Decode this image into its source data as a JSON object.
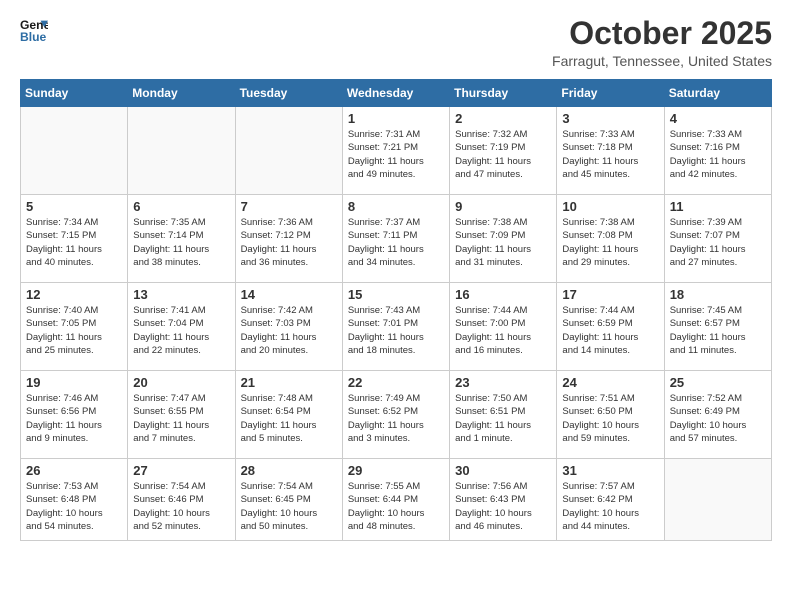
{
  "header": {
    "logo_line1": "General",
    "logo_line2": "Blue",
    "month": "October 2025",
    "location": "Farragut, Tennessee, United States"
  },
  "weekdays": [
    "Sunday",
    "Monday",
    "Tuesday",
    "Wednesday",
    "Thursday",
    "Friday",
    "Saturday"
  ],
  "weeks": [
    [
      {
        "day": "",
        "info": ""
      },
      {
        "day": "",
        "info": ""
      },
      {
        "day": "",
        "info": ""
      },
      {
        "day": "1",
        "info": "Sunrise: 7:31 AM\nSunset: 7:21 PM\nDaylight: 11 hours\nand 49 minutes."
      },
      {
        "day": "2",
        "info": "Sunrise: 7:32 AM\nSunset: 7:19 PM\nDaylight: 11 hours\nand 47 minutes."
      },
      {
        "day": "3",
        "info": "Sunrise: 7:33 AM\nSunset: 7:18 PM\nDaylight: 11 hours\nand 45 minutes."
      },
      {
        "day": "4",
        "info": "Sunrise: 7:33 AM\nSunset: 7:16 PM\nDaylight: 11 hours\nand 42 minutes."
      }
    ],
    [
      {
        "day": "5",
        "info": "Sunrise: 7:34 AM\nSunset: 7:15 PM\nDaylight: 11 hours\nand 40 minutes."
      },
      {
        "day": "6",
        "info": "Sunrise: 7:35 AM\nSunset: 7:14 PM\nDaylight: 11 hours\nand 38 minutes."
      },
      {
        "day": "7",
        "info": "Sunrise: 7:36 AM\nSunset: 7:12 PM\nDaylight: 11 hours\nand 36 minutes."
      },
      {
        "day": "8",
        "info": "Sunrise: 7:37 AM\nSunset: 7:11 PM\nDaylight: 11 hours\nand 34 minutes."
      },
      {
        "day": "9",
        "info": "Sunrise: 7:38 AM\nSunset: 7:09 PM\nDaylight: 11 hours\nand 31 minutes."
      },
      {
        "day": "10",
        "info": "Sunrise: 7:38 AM\nSunset: 7:08 PM\nDaylight: 11 hours\nand 29 minutes."
      },
      {
        "day": "11",
        "info": "Sunrise: 7:39 AM\nSunset: 7:07 PM\nDaylight: 11 hours\nand 27 minutes."
      }
    ],
    [
      {
        "day": "12",
        "info": "Sunrise: 7:40 AM\nSunset: 7:05 PM\nDaylight: 11 hours\nand 25 minutes."
      },
      {
        "day": "13",
        "info": "Sunrise: 7:41 AM\nSunset: 7:04 PM\nDaylight: 11 hours\nand 22 minutes."
      },
      {
        "day": "14",
        "info": "Sunrise: 7:42 AM\nSunset: 7:03 PM\nDaylight: 11 hours\nand 20 minutes."
      },
      {
        "day": "15",
        "info": "Sunrise: 7:43 AM\nSunset: 7:01 PM\nDaylight: 11 hours\nand 18 minutes."
      },
      {
        "day": "16",
        "info": "Sunrise: 7:44 AM\nSunset: 7:00 PM\nDaylight: 11 hours\nand 16 minutes."
      },
      {
        "day": "17",
        "info": "Sunrise: 7:44 AM\nSunset: 6:59 PM\nDaylight: 11 hours\nand 14 minutes."
      },
      {
        "day": "18",
        "info": "Sunrise: 7:45 AM\nSunset: 6:57 PM\nDaylight: 11 hours\nand 11 minutes."
      }
    ],
    [
      {
        "day": "19",
        "info": "Sunrise: 7:46 AM\nSunset: 6:56 PM\nDaylight: 11 hours\nand 9 minutes."
      },
      {
        "day": "20",
        "info": "Sunrise: 7:47 AM\nSunset: 6:55 PM\nDaylight: 11 hours\nand 7 minutes."
      },
      {
        "day": "21",
        "info": "Sunrise: 7:48 AM\nSunset: 6:54 PM\nDaylight: 11 hours\nand 5 minutes."
      },
      {
        "day": "22",
        "info": "Sunrise: 7:49 AM\nSunset: 6:52 PM\nDaylight: 11 hours\nand 3 minutes."
      },
      {
        "day": "23",
        "info": "Sunrise: 7:50 AM\nSunset: 6:51 PM\nDaylight: 11 hours\nand 1 minute."
      },
      {
        "day": "24",
        "info": "Sunrise: 7:51 AM\nSunset: 6:50 PM\nDaylight: 10 hours\nand 59 minutes."
      },
      {
        "day": "25",
        "info": "Sunrise: 7:52 AM\nSunset: 6:49 PM\nDaylight: 10 hours\nand 57 minutes."
      }
    ],
    [
      {
        "day": "26",
        "info": "Sunrise: 7:53 AM\nSunset: 6:48 PM\nDaylight: 10 hours\nand 54 minutes."
      },
      {
        "day": "27",
        "info": "Sunrise: 7:54 AM\nSunset: 6:46 PM\nDaylight: 10 hours\nand 52 minutes."
      },
      {
        "day": "28",
        "info": "Sunrise: 7:54 AM\nSunset: 6:45 PM\nDaylight: 10 hours\nand 50 minutes."
      },
      {
        "day": "29",
        "info": "Sunrise: 7:55 AM\nSunset: 6:44 PM\nDaylight: 10 hours\nand 48 minutes."
      },
      {
        "day": "30",
        "info": "Sunrise: 7:56 AM\nSunset: 6:43 PM\nDaylight: 10 hours\nand 46 minutes."
      },
      {
        "day": "31",
        "info": "Sunrise: 7:57 AM\nSunset: 6:42 PM\nDaylight: 10 hours\nand 44 minutes."
      },
      {
        "day": "",
        "info": ""
      }
    ]
  ]
}
